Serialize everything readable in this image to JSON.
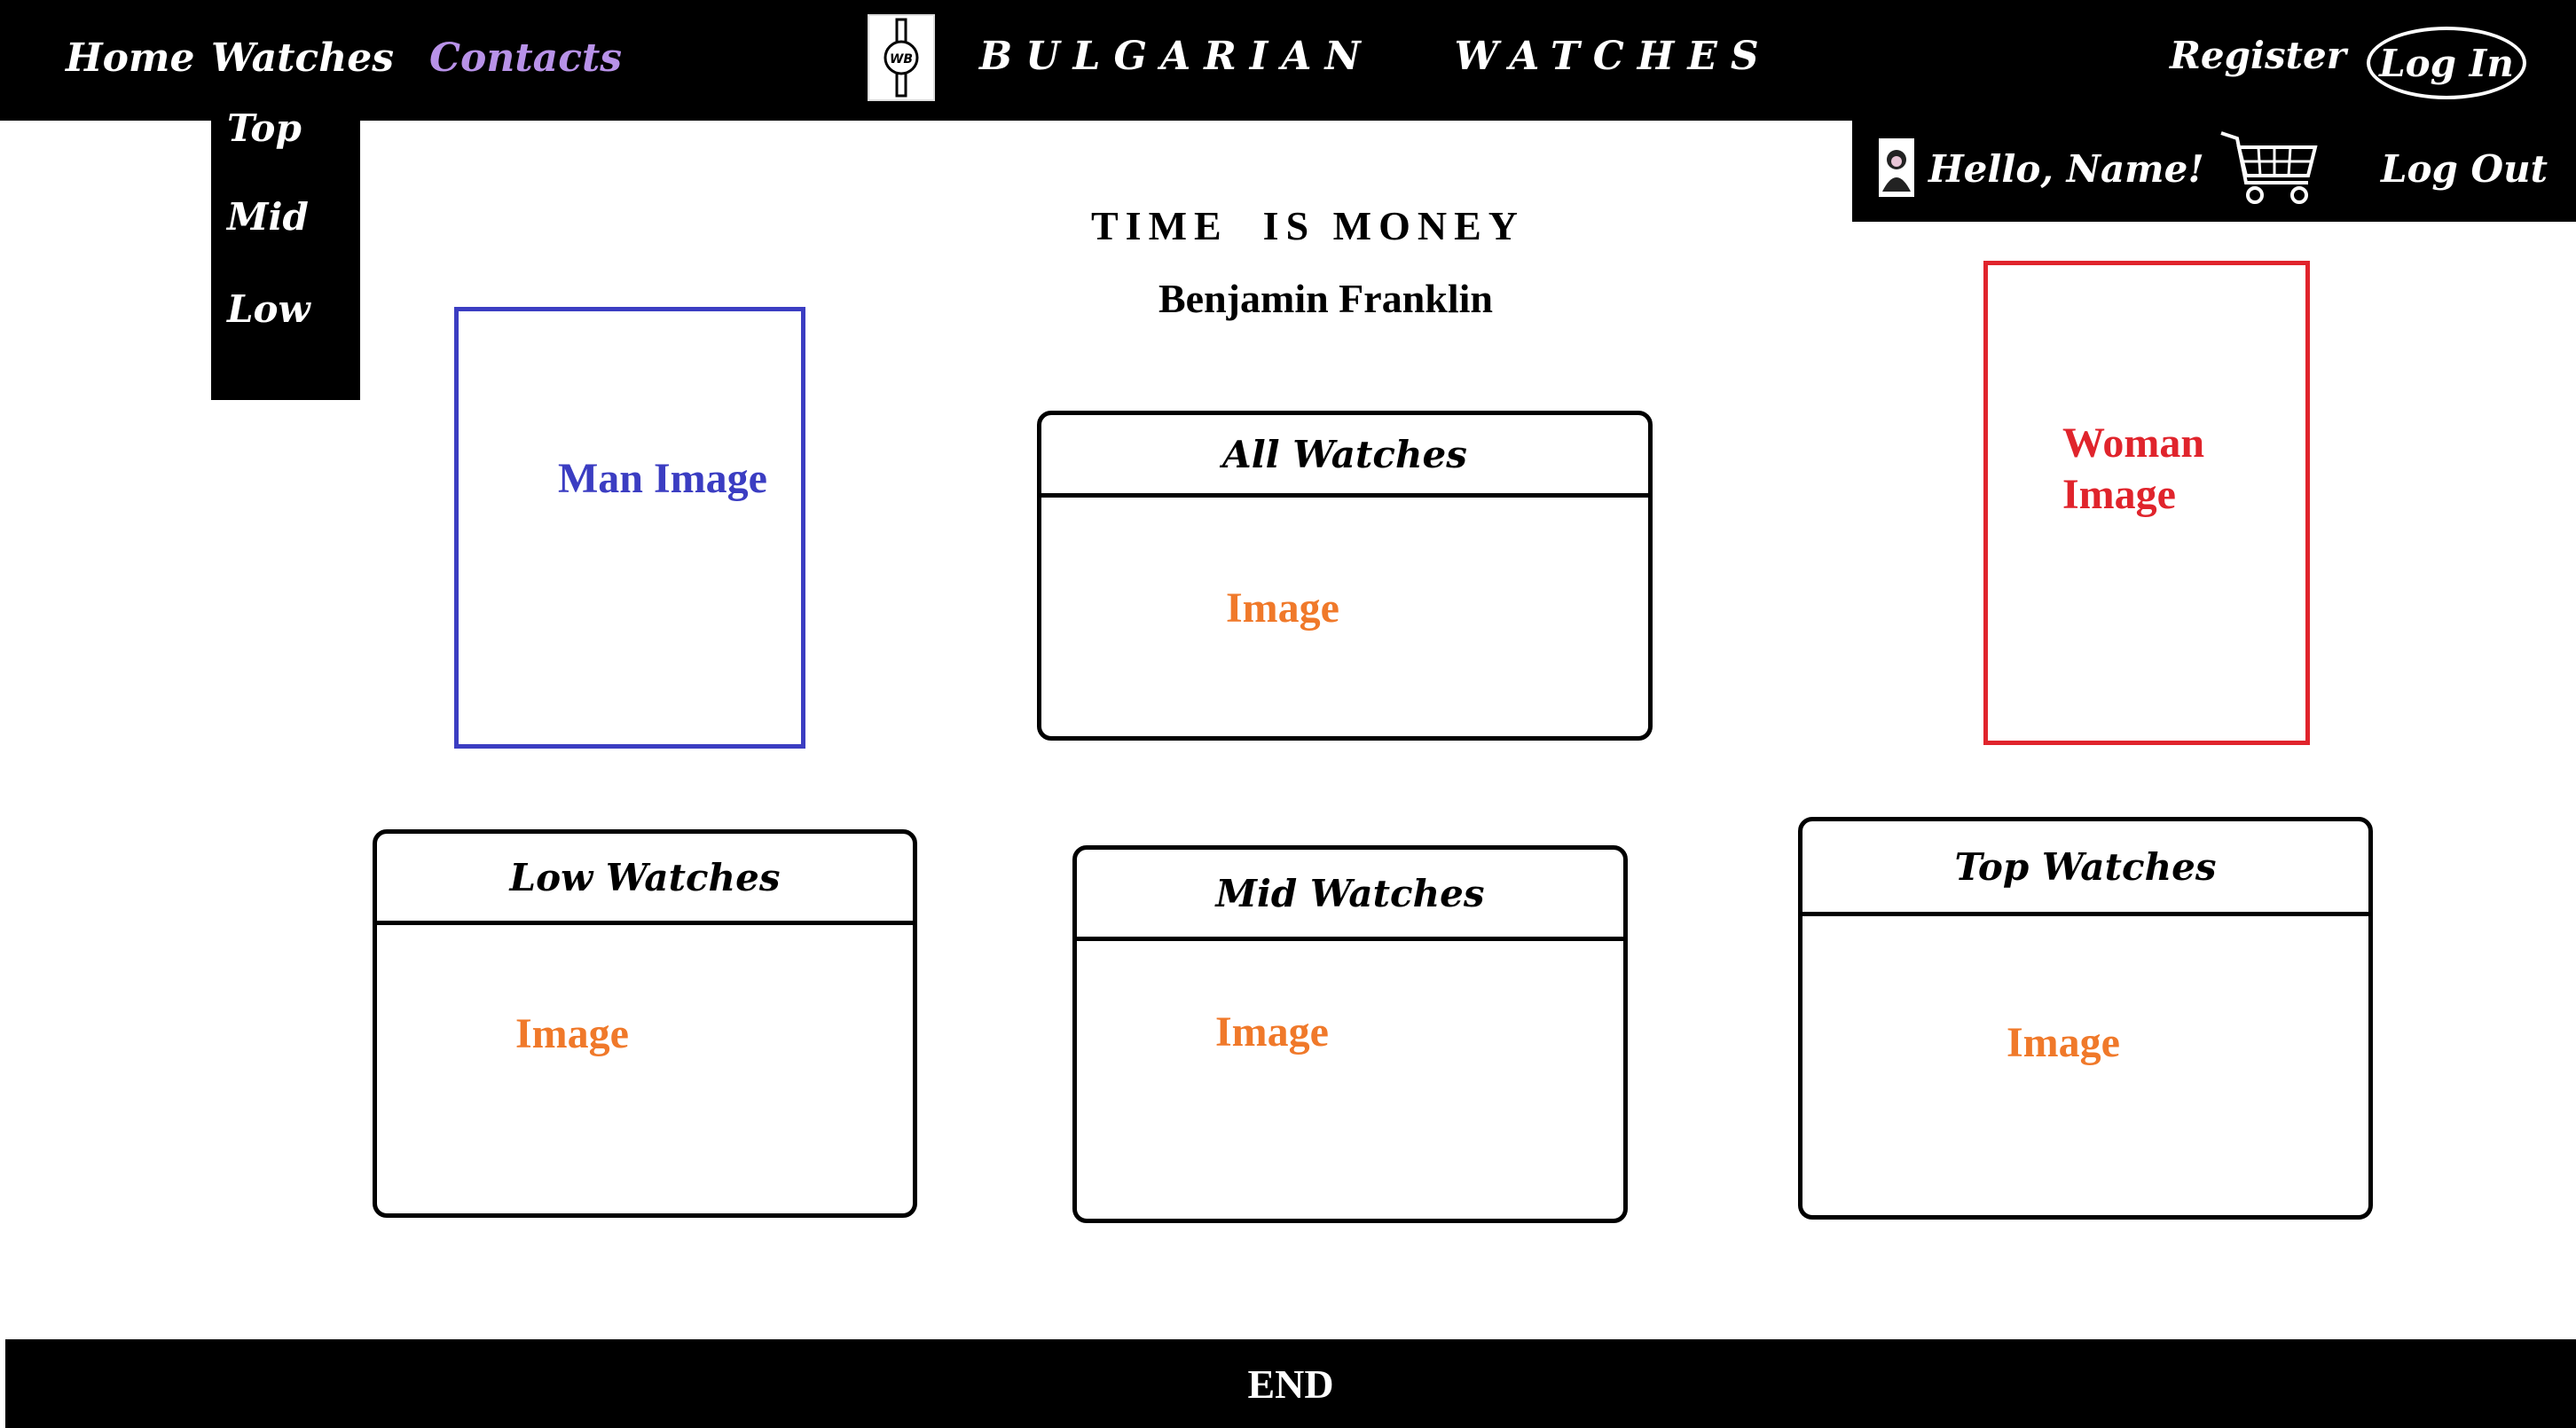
{
  "nav": {
    "home": "Home",
    "watches": "Watches",
    "contacts": "Contacts",
    "dropdown": [
      "Top",
      "Mid",
      "Low"
    ]
  },
  "header": {
    "logo_text": "WB",
    "title": "BULGARIAN   WATCHES",
    "register": "Register",
    "login": "Log In"
  },
  "user_panel": {
    "hello": "Hello, Name!",
    "logout": "Log Out",
    "cart_icon": "shopping-cart-icon",
    "avatar_icon": "user-avatar-icon"
  },
  "quote": {
    "text": "TIME  IS MONEY",
    "author": "Benjamin Franklin"
  },
  "man_image": "Man Image",
  "woman_image": "Woman Image",
  "cards": {
    "all": {
      "title": "All Watches",
      "image": "Image"
    },
    "low": {
      "title": "Low Watches",
      "image": "Image"
    },
    "mid": {
      "title": "Mid Watches",
      "image": "Image"
    },
    "top": {
      "title": "Top Watches",
      "image": "Image"
    }
  },
  "footer": {
    "text": "END"
  },
  "colors": {
    "bar": "#000000",
    "contacts_link": "#b892e8",
    "man": "#3b3dc2",
    "woman": "#e0242c",
    "image_label": "#f0792a"
  }
}
